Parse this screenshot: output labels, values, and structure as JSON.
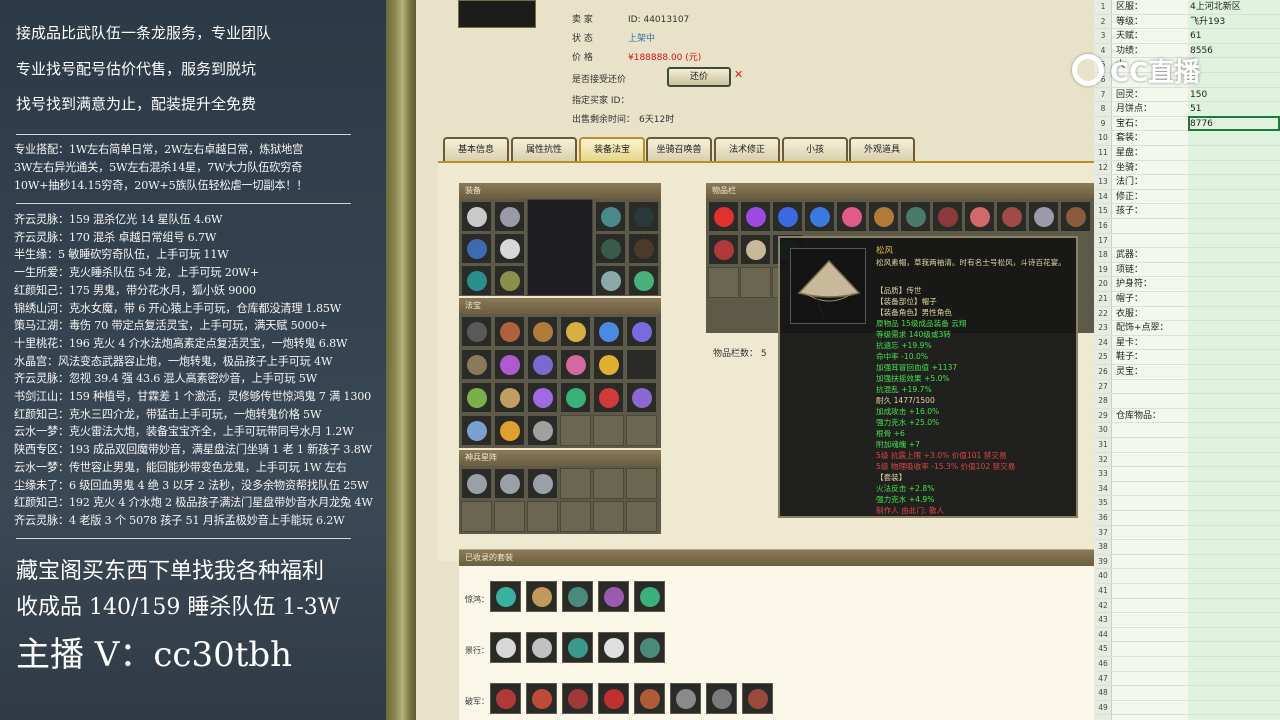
{
  "left": {
    "lines": [
      "接成品比武队伍一条龙服务，专业团队",
      "专业找号配号估价代售，服务到脱坑",
      "找号找到满意为止，配装提升全免费"
    ],
    "combo": [
      "专业搭配：1W左右简单日常，2W左右卓越日常，炼狱地宫",
      "3W左右异光通关，5W左右混杀14星，7W大力队伍砍穷奇",
      "10W+抽秒14.15穷奇，20W+5族队伍轻松虐一切副本！！"
    ],
    "listings": [
      "齐云灵脉：159 混杀亿光 14 星队伍 4.6W",
      "齐云灵脉：170 混杀 卓越日常组号 6.7W",
      "半生缘：5 敏睡砍穷奇队伍，上手可玩 11W",
      "一生所爱：克火睡杀队伍 54 龙，上手可玩 20W+",
      "红颜知己：175 男鬼，带分花水月，狐小妖 9000",
      "锦绣山河：克水女魔，带 6 开心猿上手可玩，仓库都没清理 1.85W",
      "策马江湖：毒伤 70 带定点复活灵宝，上手可玩，满天赋 5000+",
      "十里桃花：196 克火 4 介水法炮高素定点复活灵宝，一炮转鬼 6.8W",
      "水晶宫：风法变态武器容止炮，一炮转鬼，极品孩子上手可玩 4W",
      "齐云灵脉：忽视 39.4 强 43.6 混人高素密炒音，上手可玩 5W",
      "书剑江山：159 种植号，甘霖差 1 个激活，灵修够传世惊鸿鬼 7 满 1300",
      "红颜知己：克水三四介龙，带猛击上手可玩，一炮转鬼价格 5W",
      "云水一梦：克火雷法大炮，装备宝宝齐全，上手可玩带同号水月 1.2W",
      "陕西专区：193 成品双回魔带妙音，满星盘法门坐骑 1 老 1 新孩子 3.8W",
      "云水一梦：传世容止男鬼，能回能秒带变色龙鬼，上手可玩 1W 左右",
      "尘缘未了：6 级回血男鬼 4 绝 3 以牙 2 法秒，没多余物资帮找队伍 25W",
      "红颜知己：192 克火 4 介水炮 2 极品孩子满法门星盘带妙音水月龙兔 4W",
      "齐云灵脉：4 老版 3 个 5078 孩子 51 月拆孟极妙音上手能玩 6.2W"
    ],
    "big1": "藏宝阁买东西下单找我各种福利",
    "big2": "收成品 140/159 睡杀队伍 1-3W",
    "huge": "主播 V：cc30tbh"
  },
  "game": {
    "seller_label": "卖    家",
    "seller_id": "ID:  44013107",
    "status_label": "状    态",
    "status_value": "上架中",
    "price_label": "价    格",
    "price_value": "¥188888.00 (元)",
    "counter_label": "是否接受还价",
    "counter_btn": "还价",
    "buyer_label": "指定买家 ID：",
    "remain_label": "出售剩余时间：",
    "remain_value": "6天12时",
    "tabs": [
      "基本信息",
      "属性抗性",
      "装备法宝",
      "坐骑召唤兽",
      "法术修正",
      "小孩",
      "外观道具"
    ],
    "equip_head": "装备",
    "fabao_head": "法宝",
    "shenbing_head": "神兵星阵",
    "items_head": "物品栏",
    "items_count": "物品栏数：  5",
    "set_head": "已收录的套装",
    "set_rows": [
      "惊鸿：",
      "景行：",
      "破军："
    ]
  },
  "tooltip": {
    "name": "松风",
    "desc": "松风素帽，草我两袖清。时有名士号松风，斗诗百花宴。",
    "attrs": [
      {
        "t": "【品质】传世",
        "c": "y"
      },
      {
        "t": "【装备部位】帽子",
        "c": "y"
      },
      {
        "t": "【装备角色】男性角色",
        "c": "y"
      },
      {
        "t": "原物品 15级成品装备 云翔",
        "c": "g"
      },
      {
        "t": "等级需求 140级或3转",
        "c": "g"
      },
      {
        "t": "抗遗忘 +19.9%",
        "c": "g"
      },
      {
        "t": "命中率 -10.0%",
        "c": "g"
      },
      {
        "t": "加强耳冒回血值 +1137",
        "c": "g"
      },
      {
        "t": "加强扶摇效果 +5.0%",
        "c": "g"
      },
      {
        "t": "抗混乱 +19.7%",
        "c": "g"
      },
      {
        "t": "耐久 1477/1500",
        "c": "y"
      },
      {
        "t": "加成攻击 +16.0%",
        "c": "g"
      },
      {
        "t": "强力克水 +25.0%",
        "c": "g"
      },
      {
        "t": "根骨 +6",
        "c": "g"
      },
      {
        "t": "附加魂魄 +7",
        "c": "g"
      },
      {
        "t": "5级 抗震上限 +3.0% 价值101 禁交易",
        "c": "r"
      },
      {
        "t": "5级 物理吸收率 -15.3% 价值102 禁交易",
        "c": "r"
      },
      {
        "t": "【套装】",
        "c": "y"
      },
      {
        "t": "火法反击 +2.8%",
        "c": "g"
      },
      {
        "t": "强力克水 +4.9%",
        "c": "g"
      },
      {
        "t": "制作人 由此门: 散人",
        "c": "r"
      }
    ]
  },
  "sheet": {
    "rows": [
      {
        "n": "1",
        "l": "区服：",
        "v": "4上河北新区"
      },
      {
        "n": "2",
        "l": "等级：",
        "v": "飞升193"
      },
      {
        "n": "3",
        "l": "天赋：",
        "v": "61"
      },
      {
        "n": "4",
        "l": "功绩：",
        "v": "8556"
      },
      {
        "n": "5",
        "l": "大",
        "v": ""
      },
      {
        "n": "6",
        "l": "",
        "v": ""
      },
      {
        "n": "7",
        "l": "回灵：",
        "v": "150"
      },
      {
        "n": "8",
        "l": "月饼点：",
        "v": "51"
      },
      {
        "n": "9",
        "l": "宝石：",
        "v": "8776"
      },
      {
        "n": "10",
        "l": "套装：",
        "v": ""
      },
      {
        "n": "11",
        "l": "星盘：",
        "v": ""
      },
      {
        "n": "12",
        "l": "坐骑：",
        "v": ""
      },
      {
        "n": "13",
        "l": "法门：",
        "v": ""
      },
      {
        "n": "14",
        "l": "修正：",
        "v": ""
      },
      {
        "n": "15",
        "l": "孩子：",
        "v": ""
      },
      {
        "n": "16",
        "l": "",
        "v": ""
      },
      {
        "n": "17",
        "l": "",
        "v": ""
      },
      {
        "n": "18",
        "l": "武器：",
        "v": ""
      },
      {
        "n": "19",
        "l": "项链：",
        "v": ""
      },
      {
        "n": "20",
        "l": "护身符：",
        "v": ""
      },
      {
        "n": "21",
        "l": "帽子：",
        "v": ""
      },
      {
        "n": "22",
        "l": "衣服：",
        "v": ""
      },
      {
        "n": "23",
        "l": "配饰+点翠：",
        "v": ""
      },
      {
        "n": "24",
        "l": "星卡：",
        "v": ""
      },
      {
        "n": "25",
        "l": "鞋子：",
        "v": ""
      },
      {
        "n": "26",
        "l": "灵宝：",
        "v": ""
      },
      {
        "n": "27",
        "l": "",
        "v": ""
      },
      {
        "n": "28",
        "l": "",
        "v": ""
      },
      {
        "n": "29",
        "l": "仓库物品：",
        "v": ""
      },
      {
        "n": "30",
        "l": "",
        "v": ""
      },
      {
        "n": "31",
        "l": "",
        "v": ""
      },
      {
        "n": "32",
        "l": "",
        "v": ""
      },
      {
        "n": "33",
        "l": "",
        "v": ""
      },
      {
        "n": "34",
        "l": "",
        "v": ""
      },
      {
        "n": "35",
        "l": "",
        "v": ""
      },
      {
        "n": "36",
        "l": "",
        "v": ""
      },
      {
        "n": "37",
        "l": "",
        "v": ""
      },
      {
        "n": "38",
        "l": "",
        "v": ""
      },
      {
        "n": "39",
        "l": "",
        "v": ""
      },
      {
        "n": "40",
        "l": "",
        "v": ""
      },
      {
        "n": "41",
        "l": "",
        "v": ""
      },
      {
        "n": "42",
        "l": "",
        "v": ""
      },
      {
        "n": "43",
        "l": "",
        "v": ""
      },
      {
        "n": "44",
        "l": "",
        "v": ""
      },
      {
        "n": "45",
        "l": "",
        "v": ""
      },
      {
        "n": "46",
        "l": "",
        "v": ""
      },
      {
        "n": "47",
        "l": "",
        "v": ""
      },
      {
        "n": "48",
        "l": "",
        "v": ""
      },
      {
        "n": "49",
        "l": "",
        "v": ""
      }
    ],
    "overlay": "CC直播"
  },
  "colors": {
    "price": "#dd1111",
    "accent_gold": "#e6b84e",
    "attr_green": "#44e04a",
    "attr_red": "#e04444"
  }
}
